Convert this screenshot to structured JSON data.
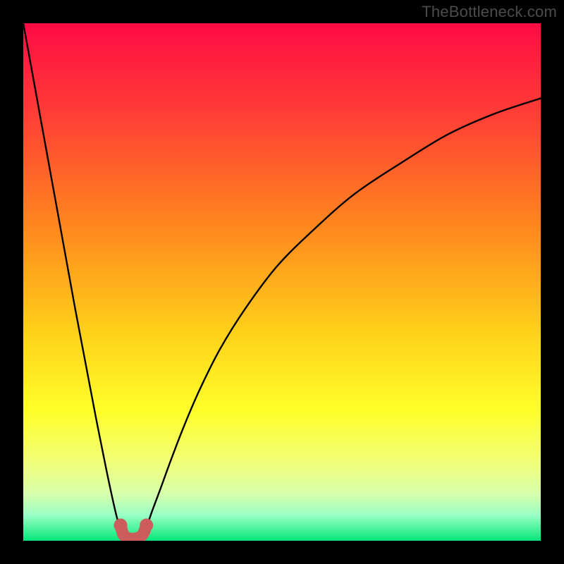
{
  "watermark": "TheBottleneck.com",
  "chart_data": {
    "type": "line",
    "title": "",
    "xlabel": "",
    "ylabel": "",
    "xlim": [
      0,
      100
    ],
    "ylim": [
      0,
      100
    ],
    "gradient_stops": [
      {
        "offset": 0,
        "color": "#ff0b45"
      },
      {
        "offset": 18,
        "color": "#ff3f35"
      },
      {
        "offset": 40,
        "color": "#ff8a1e"
      },
      {
        "offset": 60,
        "color": "#ffd21a"
      },
      {
        "offset": 75,
        "color": "#ffff2a"
      },
      {
        "offset": 85,
        "color": "#f1ff7a"
      },
      {
        "offset": 91,
        "color": "#d7ffad"
      },
      {
        "offset": 95,
        "color": "#9bffc4"
      },
      {
        "offset": 100,
        "color": "#06e77a"
      }
    ],
    "series": [
      {
        "name": "left-arm",
        "x": [
          0.0,
          2.0,
          4.0,
          6.0,
          8.0,
          10.0,
          12.0,
          14.0,
          16.0,
          17.5,
          18.5,
          19.2,
          19.8
        ],
        "y": [
          100.0,
          89.0,
          78.0,
          67.0,
          56.0,
          45.0,
          34.5,
          24.0,
          14.0,
          7.0,
          3.0,
          1.3,
          0.6
        ]
      },
      {
        "name": "right-arm",
        "x": [
          22.8,
          23.3,
          24.0,
          25.0,
          26.5,
          28.5,
          31.0,
          34.0,
          38.0,
          43.0,
          49.0,
          56.0,
          64.0,
          73.0,
          82.0,
          91.0,
          100.0
        ],
        "y": [
          0.8,
          1.6,
          3.2,
          6.0,
          10.0,
          15.5,
          22.0,
          29.0,
          37.0,
          45.0,
          53.0,
          60.0,
          67.0,
          73.0,
          78.5,
          82.5,
          85.5
        ]
      },
      {
        "name": "marker-arc",
        "x": [
          18.8,
          19.3,
          20.0,
          20.7,
          21.3,
          22.0,
          22.7,
          23.3,
          23.8
        ],
        "y": [
          3.0,
          1.3,
          0.6,
          0.4,
          0.4,
          0.5,
          0.8,
          1.6,
          3.0
        ]
      }
    ]
  }
}
